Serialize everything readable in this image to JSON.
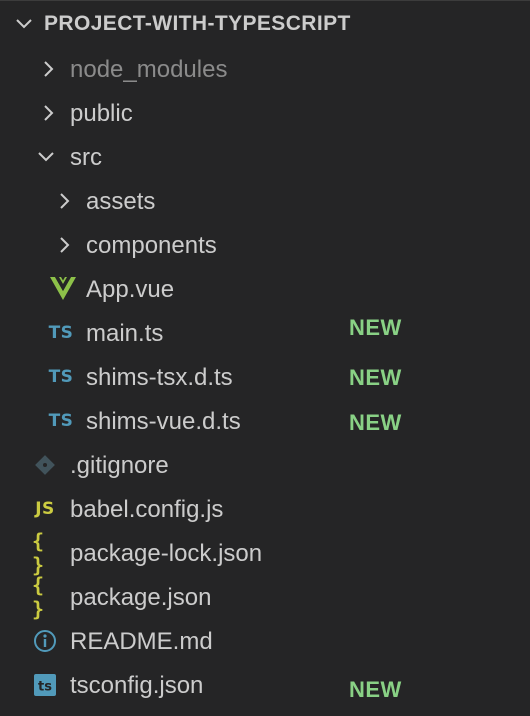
{
  "explorer": {
    "title": "PROJECT-WITH-TYPESCRIPT",
    "items": [
      {
        "label": "node_modules",
        "kind": "folder",
        "state": "collapsed",
        "icon": "chevron-right-icon"
      },
      {
        "label": "public",
        "kind": "folder",
        "state": "collapsed",
        "icon": "chevron-right-icon"
      },
      {
        "label": "src",
        "kind": "folder",
        "state": "expanded",
        "icon": "chevron-down-icon"
      },
      {
        "label": "assets",
        "kind": "folder",
        "state": "collapsed",
        "icon": "chevron-right-icon"
      },
      {
        "label": "components",
        "kind": "folder",
        "state": "collapsed",
        "icon": "chevron-right-icon"
      },
      {
        "label": "App.vue",
        "kind": "file",
        "icon": "vue-icon"
      },
      {
        "label": "main.ts",
        "kind": "file",
        "icon": "typescript-icon",
        "icon_text": "TS",
        "badge": "NEW"
      },
      {
        "label": "shims-tsx.d.ts",
        "kind": "file",
        "icon": "typescript-icon",
        "icon_text": "TS",
        "badge": "NEW"
      },
      {
        "label": "shims-vue.d.ts",
        "kind": "file",
        "icon": "typescript-icon",
        "icon_text": "TS",
        "badge": "NEW"
      },
      {
        "label": ".gitignore",
        "kind": "file",
        "icon": "git-icon"
      },
      {
        "label": "babel.config.js",
        "kind": "file",
        "icon": "javascript-icon",
        "icon_text": "JS"
      },
      {
        "label": "package-lock.json",
        "kind": "file",
        "icon": "json-icon",
        "icon_text": "{ }"
      },
      {
        "label": "package.json",
        "kind": "file",
        "icon": "json-icon",
        "icon_text": "{ }"
      },
      {
        "label": "README.md",
        "kind": "file",
        "icon": "info-icon"
      },
      {
        "label": "tsconfig.json",
        "kind": "file",
        "icon": "tsconfig-icon",
        "icon_text": "ts",
        "badge": "NEW"
      }
    ]
  },
  "colors": {
    "background": "#252526",
    "text": "#cccccc",
    "dim_text": "#8b8b8b",
    "badge_new": "#89d185",
    "typescript": "#519aba",
    "javascript_json": "#cbcb41",
    "vue": "#8dc149"
  }
}
